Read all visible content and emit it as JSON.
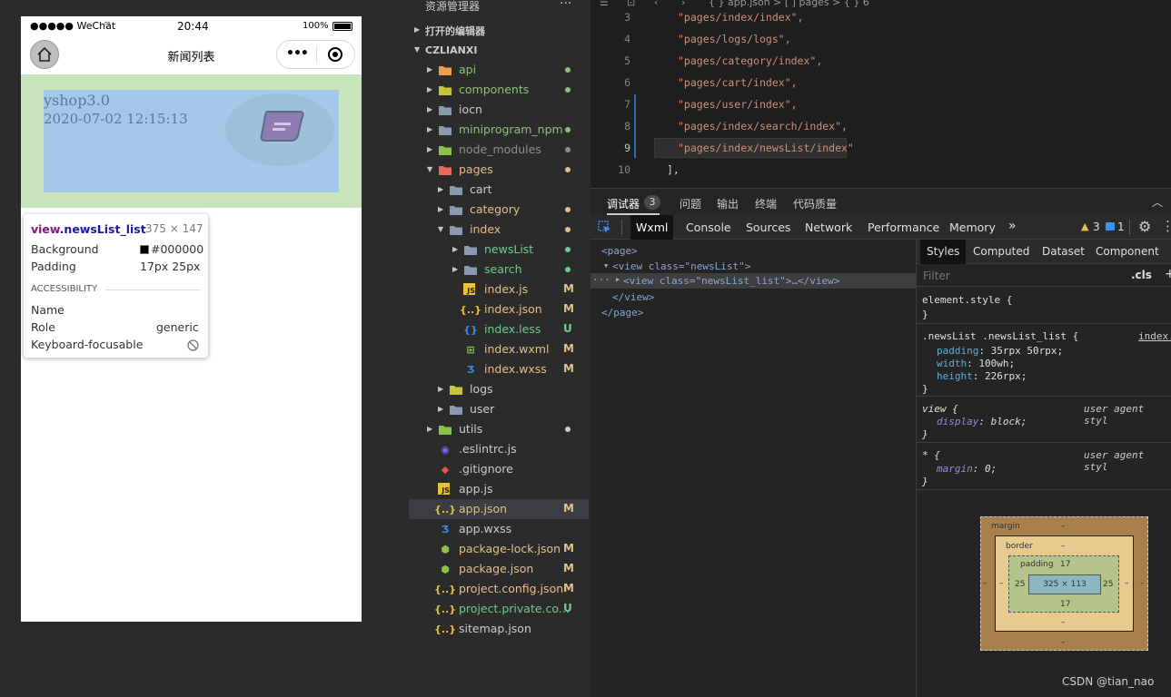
{
  "simulator": {
    "status": {
      "carrier": "●●●●● WeChat",
      "time": "20:44",
      "battery": "100%"
    },
    "nav_title": "新闻列表",
    "news_item": {
      "title": "yshop3.0",
      "date": "2020-07-02 12:15:13"
    },
    "tooltip": {
      "selector_tag": "view",
      "selector_class": ".newsList_list",
      "size": "375 × 147",
      "background_label": "Background",
      "background_value": "#000000",
      "padding_label": "Padding",
      "padding_value": "17px 25px",
      "section": "ACCESSIBILITY",
      "name_label": "Name",
      "role_label": "Role",
      "role_value": "generic",
      "keyboard_label": "Keyboard-focusable"
    }
  },
  "explorer": {
    "header": "资源管理器",
    "open_editors": "打开的编辑器",
    "project": "CZLIANXI",
    "items": [
      {
        "name": "api",
        "status": "dot",
        "color": "#8ec07c"
      },
      {
        "name": "components",
        "status": "dot",
        "color": "#8ec07c"
      },
      {
        "name": "iocn",
        "status": "",
        "color": "#cccccc"
      },
      {
        "name": "miniprogram_npm",
        "status": "dot",
        "color": "#8ec07c"
      },
      {
        "name": "node_modules",
        "status": "dot",
        "color": "#8c8c8c"
      },
      {
        "name": "pages",
        "status": "dot",
        "color": "#e2c08d"
      },
      {
        "name": "cart",
        "status": "",
        "color": "#cccccc"
      },
      {
        "name": "category",
        "status": "dot",
        "color": "#e2c08d"
      },
      {
        "name": "index",
        "status": "dot",
        "color": "#e2c08d"
      },
      {
        "name": "newsList",
        "status": "dot",
        "color": "#73c991"
      },
      {
        "name": "search",
        "status": "dot",
        "color": "#73c991"
      },
      {
        "name": "index.js",
        "status": "M",
        "color": "#e2c08d"
      },
      {
        "name": "index.json",
        "status": "M",
        "color": "#e2c08d"
      },
      {
        "name": "index.less",
        "status": "U",
        "color": "#73c991"
      },
      {
        "name": "index.wxml",
        "status": "M",
        "color": "#e2c08d"
      },
      {
        "name": "index.wxss",
        "status": "M",
        "color": "#e2c08d"
      },
      {
        "name": "logs",
        "status": "",
        "color": "#cccccc"
      },
      {
        "name": "user",
        "status": "",
        "color": "#cccccc"
      },
      {
        "name": "utils",
        "status": "dot",
        "color": "#cccccc"
      },
      {
        "name": ".eslintrc.js",
        "status": "",
        "color": "#cccccc"
      },
      {
        "name": ".gitignore",
        "status": "",
        "color": "#cccccc"
      },
      {
        "name": "app.js",
        "status": "",
        "color": "#cccccc"
      },
      {
        "name": "app.json",
        "status": "M",
        "color": "#e2c08d"
      },
      {
        "name": "app.wxss",
        "status": "",
        "color": "#cccccc"
      },
      {
        "name": "package-lock.json",
        "status": "M",
        "color": "#e2c08d"
      },
      {
        "name": "package.json",
        "status": "M",
        "color": "#e2c08d"
      },
      {
        "name": "project.config.json",
        "status": "M",
        "color": "#e2c08d"
      },
      {
        "name": "project.private.co...",
        "status": "U",
        "color": "#73c991"
      },
      {
        "name": "sitemap.json",
        "status": "",
        "color": "#cccccc"
      }
    ]
  },
  "editor": {
    "breadcrumb": "{ } app.json > [ ] pages > { } 6",
    "lines": [
      {
        "no": "3",
        "text": "\"pages/index/index\","
      },
      {
        "no": "4",
        "text": "\"pages/logs/logs\","
      },
      {
        "no": "5",
        "text": "\"pages/category/index\","
      },
      {
        "no": "6",
        "text": "\"pages/cart/index\","
      },
      {
        "no": "7",
        "text": "\"pages/user/index\","
      },
      {
        "no": "8",
        "text": "\"pages/index/search/index\","
      },
      {
        "no": "9",
        "text": "\"pages/index/newsList/index\""
      },
      {
        "no": "10",
        "text": "],"
      }
    ]
  },
  "debugger": {
    "tabs": [
      "调试器",
      "问题",
      "输出",
      "终端",
      "代码质量"
    ],
    "badge": "3",
    "tools": [
      "Wxml",
      "Console",
      "Sources",
      "Network",
      "Performance",
      "Memory"
    ],
    "more": "»",
    "warnings": "3",
    "messages": "1",
    "wxml": {
      "line1": "<page>",
      "line2": "<view class=\"newsList\">",
      "line3": "<view class=\"newsList_list\">…</view>",
      "line4": "</view>",
      "line5": "</page>"
    },
    "styles": {
      "tabs": [
        "Styles",
        "Computed",
        "Dataset",
        "Component Data"
      ],
      "filter_placeholder": "Filter",
      "cls": ".cls",
      "element_style": "element.style {",
      "rule1_selector": ".newsList .newsList_list {",
      "rule1_source": "index.",
      "rule1_props": [
        {
          "name": "padding",
          "value": "35rpx 50rpx;"
        },
        {
          "name": "width",
          "value": "100wh;"
        },
        {
          "name": "height",
          "value": "226rpx;"
        }
      ],
      "rule2_selector": "view {",
      "rule2_source": "user agent styl",
      "rule2_prop": {
        "name": "display",
        "value": "block;"
      },
      "rule3_selector": "* {",
      "rule3_source": "user agent styl",
      "rule3_prop": {
        "name": "margin",
        "value": "0;"
      },
      "close_brace": "}"
    },
    "boxmodel": {
      "margin_label": "margin",
      "margin_value": "–",
      "border_label": "border",
      "border_value": "–",
      "padding_label": "padding",
      "padding_top": "17",
      "padding_bottom": "17",
      "padding_left": "25",
      "padding_right": "25",
      "content": "325 × 113"
    }
  },
  "watermark": "CSDN @tian_nao"
}
